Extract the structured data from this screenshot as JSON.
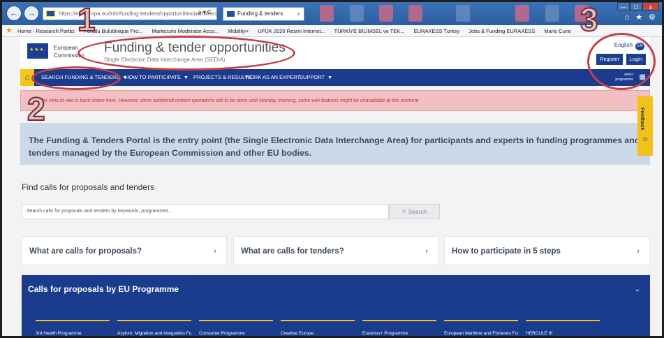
{
  "browser": {
    "address": "https://ec.europa.eu/info/funding-tenders/opportunities/portal/scr",
    "address_controls": "ρ ▾ C",
    "tab_title": "Funding & tenders",
    "tab_close": "×",
    "right_icons": "⌂ ★ ⚙",
    "window_controls": [
      "—",
      "□",
      "x"
    ]
  },
  "bookmarks": [
    "Home - Research Partici",
    "Portalu Bulutlinique Pro...",
    "Mariecurie Moderator Acco...",
    "Mobility+",
    "UFUK 2020 Resmi Internet...",
    "TÜRKİYE BİLİMSEL ve TEK...",
    "EURAXESS Turkey",
    "Jobs & Funding EURAXESS",
    "Marie Curie"
  ],
  "site": {
    "logo_text": "European Commission",
    "title": "Funding & tender opportunities",
    "subtitle": "Single Electronic Data Interchange Area (SEDIA)",
    "language": "English",
    "language_code": "EN",
    "register": "Register",
    "login": "Login"
  },
  "nav": {
    "home_icon": "home-icon",
    "items": [
      "SEARCH FUNDING & TENDERS",
      "HOW TO PARTICIPATE",
      "PROJECTS & RESULTS",
      "WORK AS AN EXPERT",
      "SUPPORT"
    ],
    "select_programme": "select programme"
  },
  "alert": {
    "text": "The How to wiki is back online here. However, since additional restore operations still to be done until Monday morning, some wiki features might be unavailable at this moment"
  },
  "intro": {
    "text": "The Funding & Tenders Portal is the entry point (the Single Electronic Data Interchange Area) for participants and experts in funding programmes and tenders managed by the European Commission and other EU bodies."
  },
  "feedback": {
    "label": "Feedback"
  },
  "find": {
    "title": "Find calls for proposals and tenders",
    "placeholder": "Search calls for proposals and tenders by keywords, programmes...",
    "search_button": "Search"
  },
  "cards": [
    "What are calls for proposals?",
    "What are calls for tenders?",
    "How to participate in 5 steps"
  ],
  "programmes": {
    "title": "Calls for proposals by EU Programme",
    "items": [
      "3rd Health Programme",
      "Asylum, Migration and Integration Fund",
      "Consumer Programme",
      "Creative Europe",
      "Erasmus+ Programme",
      "European Maritime and Fisheries Fund",
      "HERCULE III"
    ]
  },
  "annotations": {
    "numbers": [
      "1",
      "2",
      "3"
    ],
    "color": "#c43f48"
  },
  "colors": {
    "nav_blue": "#1b3b8d",
    "accent_yellow": "#f3c119",
    "alert_bg": "#f2bfc2",
    "intro_bg": "#cbd8e8"
  }
}
